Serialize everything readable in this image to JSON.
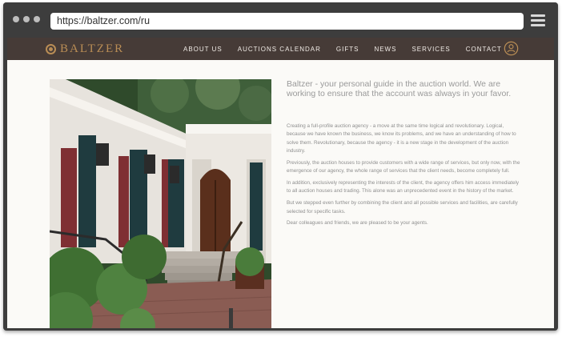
{
  "browser": {
    "url": "https://baltzer.com/ru"
  },
  "site": {
    "logo_text": "BALTZER",
    "accent_color": "#b98d55",
    "nav_background": "#463b37",
    "nav": [
      {
        "label": "ABOUT US"
      },
      {
        "label": "AUCTIONS CALENDAR"
      },
      {
        "label": "GIFTS"
      },
      {
        "label": "NEWS"
      },
      {
        "label": "SERVICES"
      },
      {
        "label": "CONTACT"
      }
    ],
    "user_icon": "user-icon"
  },
  "content": {
    "intro": "Baltzer - your personal guide in the auction world. We are working to ensure that the account was always in your favor.",
    "paragraphs": [
      "Creating a full-profile auction agency - a move at the same time logical and revolutionary. Logical, because we have known the business, we know its problems, and we have an understanding of how to solve them. Revolutionary, because the agency - it is a new stage in the development of the auction industry.",
      "Previously, the auction houses to provide customers with a wide range of services, but only now, with the emergence of our agency, the whole range of services that the client needs, become completely full.",
      "In addition, exclusively representing the interests of the client, the agency offers him access immediately to all auction houses and trading. This alone was an unprecedented event in the history of the market.",
      "But we stepped even further by combining the client and all possible services and facilities, are carefully selected for specific tasks.",
      "Dear colleagues and friends, we are pleased to be your agents."
    ]
  }
}
